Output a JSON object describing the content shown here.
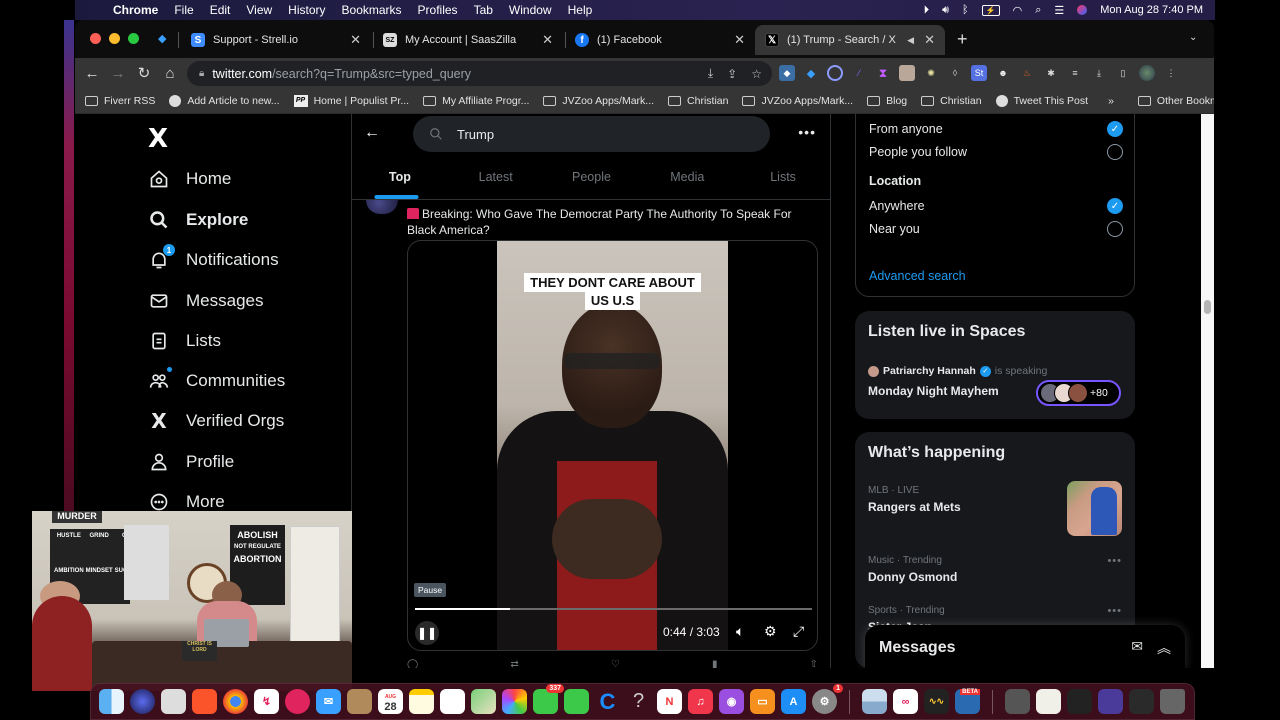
{
  "menubar": {
    "app": "Chrome",
    "items": [
      "File",
      "Edit",
      "View",
      "History",
      "Bookmarks",
      "Profiles",
      "Tab",
      "Window",
      "Help"
    ],
    "clock": "Mon Aug 28  7:40 PM"
  },
  "browser": {
    "tabs": [
      {
        "title": "Support - Strell.io",
        "icon": "strell-icon",
        "active": false
      },
      {
        "title": "My Account | SaasZilla",
        "icon": "saaszilla-icon",
        "active": false
      },
      {
        "title": "(1) Facebook",
        "icon": "facebook-icon",
        "active": false
      },
      {
        "title": "(1) Trump - Search / X",
        "icon": "x-icon",
        "active": true,
        "audio": true
      }
    ],
    "url_host": "twitter.com",
    "url_path": "/search?q=Trump&src=typed_query",
    "extensions_initials": {
      "st": "St"
    },
    "bookmarks": [
      {
        "label": "Fiverr RSS",
        "icon": "folder-icon"
      },
      {
        "label": "Add Article to new...",
        "icon": "globe-icon"
      },
      {
        "label": "Home | Populist Pr...",
        "icon": "pp-icon"
      },
      {
        "label": "My Affiliate Progr...",
        "icon": "folder-icon"
      },
      {
        "label": "JVZoo Apps/Mark...",
        "icon": "folder-icon"
      },
      {
        "label": "Christian",
        "icon": "folder-icon"
      },
      {
        "label": "JVZoo Apps/Mark...",
        "icon": "folder-icon"
      },
      {
        "label": "Blog",
        "icon": "folder-icon"
      },
      {
        "label": "Christian",
        "icon": "folder-icon"
      },
      {
        "label": "Tweet This Post",
        "icon": "globe-icon"
      }
    ],
    "bookmarks_overflow": "»",
    "other_bookmarks": "Other Bookmarks"
  },
  "nav": {
    "logo": "X",
    "items": [
      {
        "label": "Home",
        "icon": "home-icon"
      },
      {
        "label": "Explore",
        "icon": "search-icon",
        "active": true
      },
      {
        "label": "Notifications",
        "icon": "bell-icon",
        "badge": "1"
      },
      {
        "label": "Messages",
        "icon": "envelope-icon"
      },
      {
        "label": "Lists",
        "icon": "list-icon"
      },
      {
        "label": "Communities",
        "icon": "communities-icon",
        "dot": true
      },
      {
        "label": "Verified Orgs",
        "icon": "x-logo-icon"
      },
      {
        "label": "Profile",
        "icon": "person-icon"
      },
      {
        "label": "More",
        "icon": "more-circle-icon"
      }
    ]
  },
  "search": {
    "query": "Trump",
    "tabs": [
      "Top",
      "Latest",
      "People",
      "Media",
      "Lists"
    ],
    "active_tab": "Top"
  },
  "tweet": {
    "text": "Breaking: Who Gave The Democrat Party The Authority To Speak For Black America?",
    "video": {
      "caption_line1": "THEY DONT CARE ABOUT",
      "caption_line2": "US U.S",
      "tooltip": "Pause",
      "current": "0:44",
      "duration": "3:03",
      "time_display": "0:44 / 3:03",
      "progress_fraction": 0.24
    }
  },
  "filters": {
    "people_options": [
      {
        "label": "From anyone",
        "selected": true
      },
      {
        "label": "People you follow",
        "selected": false
      }
    ],
    "location_heading": "Location",
    "location_options": [
      {
        "label": "Anywhere",
        "selected": true
      },
      {
        "label": "Near you",
        "selected": false
      }
    ],
    "advanced_link": "Advanced search"
  },
  "spaces": {
    "title": "Listen live in Spaces",
    "host": "Patriarchy Hannah",
    "status": "is speaking",
    "name": "Monday Night Mayhem",
    "listener_count": "+80",
    "accent": "#7856ff"
  },
  "trends": {
    "title": "What’s happening",
    "items": [
      {
        "meta": "MLB · LIVE",
        "name": "Rangers at Mets",
        "has_image": true
      },
      {
        "meta": "Music · Trending",
        "name": "Donny Osmond"
      },
      {
        "meta": "Sports · Trending",
        "name": "Sister Jean"
      }
    ]
  },
  "messages_drawer": {
    "title": "Messages"
  },
  "webcam": {
    "poster_left_top": "MURDER",
    "poster_grid": [
      "HUSTLE",
      "GRIND",
      "GRIT",
      "AMBITION",
      "MINDSET",
      "SUCCESS"
    ],
    "poster_right": [
      "ABOLISH",
      "NOT REGULATE",
      "ABORTION"
    ],
    "sign": "CHRIST IS LORD"
  },
  "dock": {
    "calendar_month": "AUG",
    "calendar_day": "28",
    "messages_badge": "337",
    "settings_badge": "1",
    "beta_label": "BETA"
  },
  "colors": {
    "accent": "#1d9bf0",
    "background": "#000000",
    "card": "#16181c",
    "muted_text": "#71767b"
  }
}
